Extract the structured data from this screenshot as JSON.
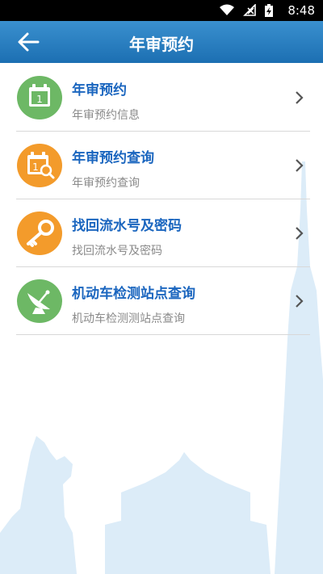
{
  "status_bar": {
    "time": "8:48"
  },
  "header": {
    "title": "年审预约"
  },
  "menu": [
    {
      "title": "年审预约",
      "subtitle": "年审预约信息",
      "icon": "calendar-icon",
      "color": "#6db865"
    },
    {
      "title": "年审预约查询",
      "subtitle": "年审预约查询",
      "icon": "calendar-search-icon",
      "color": "#f39b2b"
    },
    {
      "title": "找回流水号及密码",
      "subtitle": "找回流水号及密码",
      "icon": "key-icon",
      "color": "#f39b2b"
    },
    {
      "title": "机动车检测站点查询",
      "subtitle": "机动车检测测站点查询",
      "icon": "satellite-dish-icon",
      "color": "#6db865"
    }
  ],
  "colors": {
    "header": "#2a80c3",
    "title_text": "#1b66bf",
    "background_art": "#dcecf8"
  }
}
